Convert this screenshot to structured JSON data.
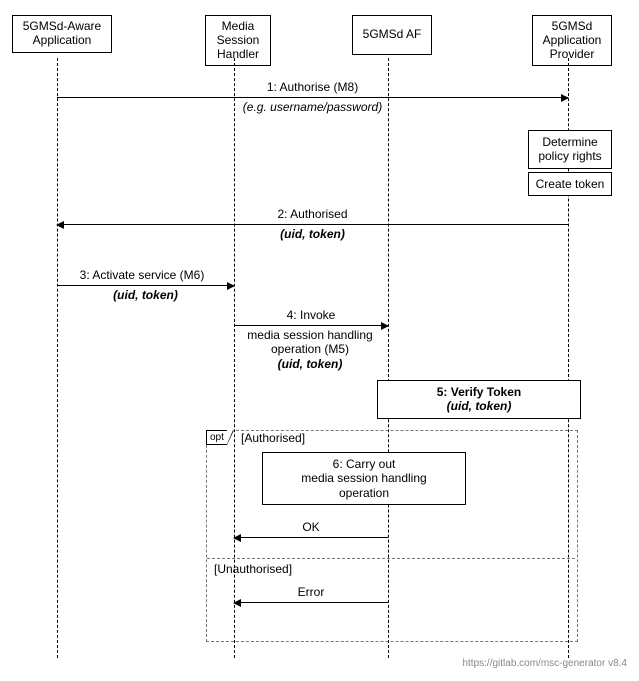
{
  "participants": {
    "p1": "5GMSd-Aware\nApplication",
    "p2": "Media\nSession\nHandler",
    "p3": "5GMSd AF",
    "p4": "5GMSd\nApplication\nProvider"
  },
  "messages": {
    "m1_label": "1: Authorise (M8)",
    "m1_note": "(e.g. username/password)",
    "box_determine": "Determine\npolicy rights",
    "box_create": "Create token",
    "m2_label": "2: Authorised",
    "m2_note": "(uid, token)",
    "m3_label": "3: Activate service (M6)",
    "m3_note": "(uid, token)",
    "m4_label": "4: Invoke",
    "m4_line2": "media session handling",
    "m4_line3": "operation (M5)",
    "m4_note": "(uid, token)",
    "m5_label": "5: Verify Token",
    "m5_note": "(uid, token)",
    "opt_tag": "opt",
    "guard1": "[Authorised]",
    "m6_label": "6: Carry out",
    "m6_line2": "media session handling",
    "m6_line3": "operation",
    "ok_label": "OK",
    "guard2": "[Unauthorised]",
    "err_label": "Error"
  },
  "footer": "https://gitlab.com/msc-generator v8.4"
}
